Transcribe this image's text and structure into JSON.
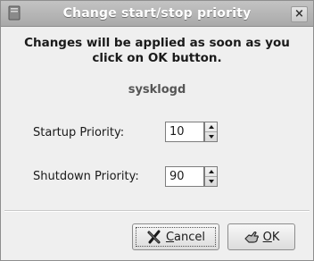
{
  "window": {
    "title": "Change start/stop priority",
    "close_glyph": "×",
    "window_icon": "document-icon"
  },
  "dialog": {
    "message_line1": "Changes will be applied as soon as you",
    "message_line2": "click on OK button.",
    "service_name": "sysklogd"
  },
  "startup": {
    "label": "Startup Priority:",
    "value": "10"
  },
  "shutdown": {
    "label": "Shutdown Priority:",
    "value": "90"
  },
  "buttons": {
    "cancel": {
      "mnemonic": "C",
      "rest": "ancel",
      "icon": "cancel-x-icon"
    },
    "ok": {
      "mnemonic": "O",
      "rest": "K",
      "icon": "ok-hand-icon"
    }
  }
}
